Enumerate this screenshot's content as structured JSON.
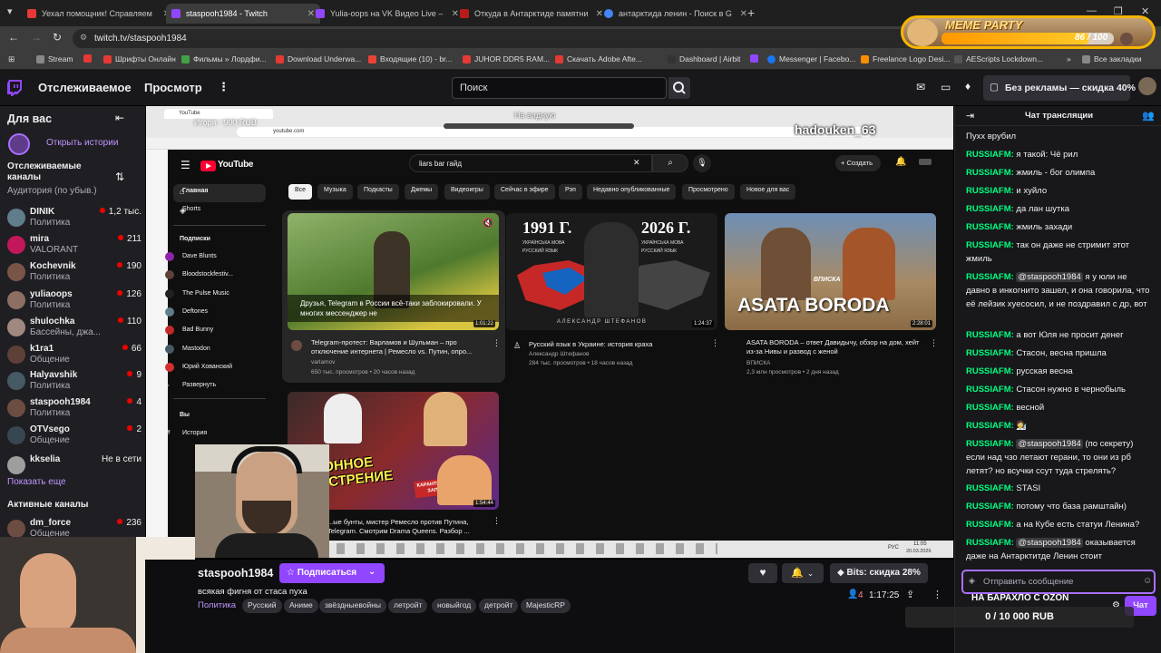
{
  "browser": {
    "tabs": [
      {
        "label": "Уехал помощник! Справляем",
        "color": "#e53935"
      },
      {
        "label": "staspooh1984 - Twitch",
        "color": "#9146ff",
        "active": true
      },
      {
        "label": "Yulia-oops на VK Видео Live –",
        "color": "#9146ff"
      },
      {
        "label": "Откуда в Антарктиде памятни",
        "color": "#b71c1c"
      },
      {
        "label": "антарктида ленин - Поиск в G",
        "color": "#4285f4"
      }
    ],
    "url": "twitch.tv/staspooh1984",
    "bookmarks": [
      {
        "label": "Stream",
        "color": "#888"
      },
      {
        "label": "Шрифты Онлайн",
        "color": "#e53935"
      },
      {
        "label": "Фильмы » Лордфи...",
        "color": "#43a047"
      },
      {
        "label": "Download Underwa...",
        "color": "#e53935"
      },
      {
        "label": "Входящие (10) - br...",
        "color": "#ea4335"
      },
      {
        "label": "JUHOR DDR5 RAM...",
        "color": "#e53935"
      },
      {
        "label": "Скачать Adobe Afte...",
        "color": "#e53935"
      },
      {
        "label": "Dashboard | Airbit",
        "color": "#333"
      },
      {
        "label": "Messenger | Facebo...",
        "color": "#1877f2"
      },
      {
        "label": "Freelance Logo Desi...",
        "color": "#fb8c00"
      },
      {
        "label": "AEScripts Lockdown...",
        "color": "#555"
      },
      {
        "label": "Все закладки",
        "color": "#888"
      }
    ]
  },
  "header": {
    "nav_following": "Отслеживаемое",
    "nav_browse": "Просмотр",
    "search_placeholder": "Поиск",
    "promo": "Без рекламы — скидка 40%"
  },
  "overlay": {
    "meme_title": "MEME PARTY",
    "meme_count": "86 / 100",
    "streamer_tag": "hadouken_63",
    "ghost_top": "На видную",
    "goal_title": "НА БАРАХЛО С OZON",
    "goal_amount": "0 / 10 000 RUB",
    "ghost_top_left": "Игоря - 900 RUB"
  },
  "sidebar": {
    "for_you": "Для вас",
    "open_stories": "Открыть истории",
    "followed_title": "Отслеживаемые каналы",
    "followed_sub": "Аудитория (по убыв.)",
    "channels": [
      {
        "name": "DINIK",
        "game": "Политика",
        "viewers": "1,2 тыс.",
        "color": "#607d8b"
      },
      {
        "name": "mira",
        "game": "VALORANT",
        "viewers": "211",
        "color": "#c2185b"
      },
      {
        "name": "Kochevnik",
        "game": "Политика",
        "viewers": "190",
        "color": "#795548"
      },
      {
        "name": "yuliaoops",
        "game": "Политика",
        "viewers": "126",
        "color": "#8d6e63"
      },
      {
        "name": "shulochka",
        "game": "Бассейны, джа...",
        "viewers": "110",
        "color": "#a1887f"
      },
      {
        "name": "k1ra1",
        "game": "Общение",
        "viewers": "66",
        "color": "#5d4037"
      },
      {
        "name": "Halyavshik",
        "game": "Политика",
        "viewers": "9",
        "color": "#455a64"
      },
      {
        "name": "staspooh1984",
        "game": "Политика",
        "viewers": "4",
        "color": "#6d4c41"
      },
      {
        "name": "OTVsego",
        "game": "Общение",
        "viewers": "2",
        "color": "#37474f"
      },
      {
        "name": "kkselia",
        "game": "",
        "viewers": "Не в сети",
        "color": "#9e9e9e",
        "offline": true
      }
    ],
    "show_more": "Показать еще",
    "active_title": "Активные каналы",
    "active": [
      {
        "name": "dm_force",
        "game": "Общение",
        "viewers": "236",
        "color": "#6d4c41"
      }
    ]
  },
  "youtube": {
    "search_value": "liars bar гайд",
    "create": "Создать",
    "logo": "YouTube",
    "nav": [
      "Главная",
      "Shorts"
    ],
    "subs_title": "Подписки",
    "subs": [
      {
        "name": "Dave Blunts",
        "color": "#8e24aa"
      },
      {
        "name": "Bloodstockfestiv...",
        "color": "#5d4037"
      },
      {
        "name": "The Pulse Music",
        "color": "#212121"
      },
      {
        "name": "Deftones",
        "color": "#607d8b"
      },
      {
        "name": "Bad Bunny",
        "color": "#c62828"
      },
      {
        "name": "Mastodon",
        "color": "#455a64"
      },
      {
        "name": "Юрий Хованский",
        "color": "#d32f2f"
      }
    ],
    "expand": "Развернуть",
    "you": "Вы",
    "history": "История",
    "chips": [
      "Все",
      "Музыка",
      "Подкасты",
      "Джемы",
      "Видеоигры",
      "Сейчас в эфире",
      "Рэп",
      "Недавно опубликованные",
      "Просмотрено",
      "Новое для вас"
    ],
    "videos": [
      {
        "title": "Telegram-протест: Варламов и Шульман – про отключение интернета | Ремесло vs. Путин, опро...",
        "channel": "varlamov",
        "meta": "650 тыс. просмотров • 20 часов назад",
        "duration": "1:01:22",
        "caption": "Друзья, Telegram в России всё-таки заблокировали. У многих мессенджер не"
      },
      {
        "title": "Русский язык в Украине: история краха",
        "channel": "Александр Штефанов",
        "meta": "284 тыс. просмотров • 18 часов назад",
        "duration": "1:24:37",
        "caption_left": "1991 Г.",
        "caption_right": "2026 Г.",
        "lang_a": "УКРАЇНСЬКА МОВА",
        "lang_b": "РУССКИЙ ЯЗЫК",
        "author_caption": "АЛЕКСАНДР ШТЕФАНОВ"
      },
      {
        "title": "ASATA BORODA – ответ Давидычу, обзор на дом, хейт из-за Нивы и развод с женой",
        "channel": "ВПИСКА",
        "meta": "2,3 млн просмотров • 2 дня назад",
        "duration": "2:28:01",
        "caption": "ASATA BORODA",
        "badge": "ВПИСКА"
      },
      {
        "title": "...ые бунты, мистер Ремесло против Путина, Telegram. Смотрим Drama Queens. Разбор ...",
        "channel": "",
        "meta": "",
        "duration": "1:54:44",
        "caption": "СЕЗОННОЕ ОБОСТРЕНИЕ",
        "sticker": "КАРАНТИН ПРОЕЗД ЗАПРЕЩЁН"
      }
    ],
    "clock": "11:05",
    "date": "20.03.2026",
    "lang": "РУС"
  },
  "stream": {
    "channel": "staspooh1984",
    "subscribe": "Подписаться",
    "title": "всякая фигня от стаса пуха",
    "category": "Политика",
    "tags": [
      "Русский",
      "Аниме",
      "звёздныевойны",
      "летройт",
      "новыйгод",
      "детройт",
      "MajesticRP"
    ],
    "viewers": "4",
    "uptime": "1:17:25",
    "bits": "Bits: скидка 28%"
  },
  "chat": {
    "title": "Чат трансляции",
    "placeholder": "Отправить сообщение",
    "send": "Чат",
    "messages": [
      {
        "user": "",
        "text": "Пухх врубил"
      },
      {
        "user": "RUSSIAFM:",
        "text": "я такой: Чё рил"
      },
      {
        "user": "RUSSIAFM:",
        "text": "жмиль - бог олимпа"
      },
      {
        "user": "RUSSIAFM:",
        "text": "и хуйло"
      },
      {
        "user": "RUSSIAFM:",
        "text": "да лан шутка"
      },
      {
        "user": "RUSSIAFM:",
        "text": "жмиль захади"
      },
      {
        "user": "RUSSIAFM:",
        "text": "так он даже не стримит этот жмиль"
      },
      {
        "user": "RUSSIAFM:",
        "mention": "@staspooh1984",
        "text": "я у юли не давно в инкогнито зашел, и она говорила, что её лейзик хуесосил, и не поздравил с др, вот"
      },
      {
        "user": "RUSSIAFM:",
        "text": "а вот Юля не просит денег"
      },
      {
        "user": "RUSSIAFM:",
        "text": "Стасон, весна пришла"
      },
      {
        "user": "RUSSIAFM:",
        "text": "русская весна"
      },
      {
        "user": "RUSSIAFM:",
        "text": "Стасон нужно в чернобыль"
      },
      {
        "user": "RUSSIAFM:",
        "text": "весной"
      },
      {
        "user": "RUSSIAFM:",
        "text": "🧑‍🔬"
      },
      {
        "user": "RUSSIAFM:",
        "mention": "@staspooh1984",
        "text": "(по секрету) если над чзо летают герани, то они из рб летят? но всучки ссут туда стрелять?"
      },
      {
        "user": "RUSSIAFM:",
        "text": "STASI"
      },
      {
        "user": "RUSSIAFM:",
        "text": "потому что база рамштайн)"
      },
      {
        "user": "RUSSIAFM:",
        "text": "а на Кубе есть статуи Ленина?"
      },
      {
        "user": "RUSSIAFM:",
        "mention": "@staspooh1984",
        "text": "оказывается даже на Антарктитде Ленин стоит"
      }
    ]
  }
}
